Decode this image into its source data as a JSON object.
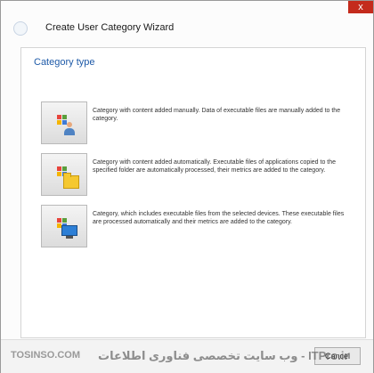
{
  "window": {
    "title": "Create User Category Wizard",
    "close_label": "x"
  },
  "section": {
    "title": "Category type"
  },
  "options": [
    {
      "text": "Category with content added manually. Data of executable files are manually added to the category.",
      "icon": "apps-grid-user-icon"
    },
    {
      "text": "Category with content added automatically. Executable files of applications copied to the specified folder are automatically processed, their metrics are added to the category.",
      "icon": "apps-grid-folder-icon"
    },
    {
      "text": "Category, which includes executable files from the selected devices. These executable files are processed automatically and their metrics are added to the category.",
      "icon": "apps-grid-monitor-icon"
    }
  ],
  "footer": {
    "cancel_label": "Cancel"
  },
  "watermark": {
    "left": "TOSINSO.COM",
    "right": "ITPro.ir - وب سایت تخصصی فناوری اطلاعات"
  },
  "colors": {
    "section_title": "#1e5aa8",
    "close_button": "#c42b1c"
  }
}
